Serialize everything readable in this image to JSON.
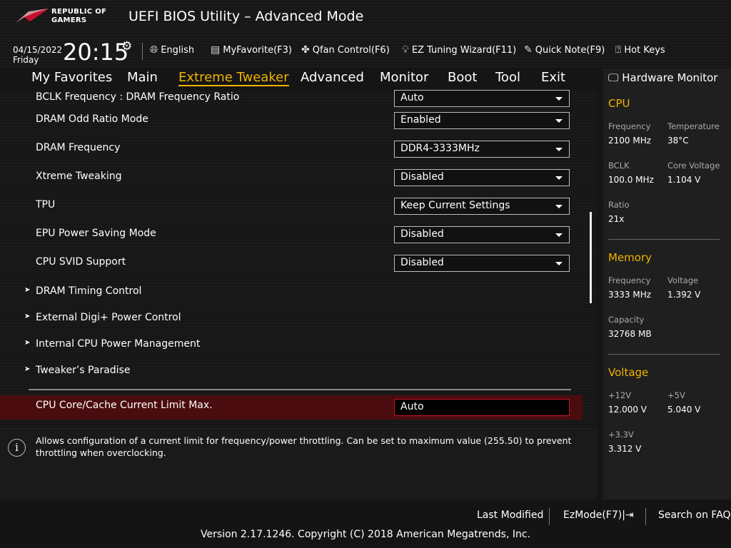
{
  "header": {
    "logo_text": [
      "REPUBLIC OF",
      "GAMERS"
    ],
    "title": "UEFI BIOS Utility – Advanced Mode",
    "date": "04/15/2022",
    "day": "Friday",
    "time": "20:15"
  },
  "toolbar": {
    "english": "English",
    "myfavorite": "MyFavorite(F3)",
    "qfan": "Qfan Control(F6)",
    "ez_tuning": "EZ Tuning Wizard(F11)",
    "quick_note": "Quick Note(F9)",
    "hot_keys": "Hot Keys"
  },
  "tabs": [
    "My Favorites",
    "Main",
    "Extreme Tweaker",
    "Advanced",
    "Monitor",
    "Boot",
    "Tool",
    "Exit"
  ],
  "settings": [
    {
      "label": "BCLK Frequency : DRAM Frequency Ratio",
      "value": "Auto"
    },
    {
      "label": "DRAM Odd Ratio Mode",
      "value": "Enabled"
    },
    {
      "label": "DRAM Frequency",
      "value": "DDR4-3333MHz"
    },
    {
      "label": "Xtreme Tweaking",
      "value": "Disabled"
    },
    {
      "label": "TPU",
      "value": "Keep Current Settings"
    },
    {
      "label": "EPU Power Saving Mode",
      "value": "Disabled"
    },
    {
      "label": "CPU SVID Support",
      "value": "Disabled"
    }
  ],
  "submenus": [
    "DRAM Timing Control",
    "External Digi+ Power Control",
    "Internal CPU Power Management",
    "Tweaker’s Paradise"
  ],
  "selected": {
    "label": "CPU Core/Cache Current Limit Max.",
    "value": "Auto"
  },
  "help": "Allows configuration of a current limit for frequency/power throttling. Can be set to maximum value (255.50) to prevent throttling when overclocking.",
  "hw": {
    "title": "Hardware Monitor",
    "cpu": {
      "title": "CPU",
      "freq_k": "Frequency",
      "freq": "2100 MHz",
      "temp_k": "Temperature",
      "temp": "38°C",
      "bclk_k": "BCLK",
      "bclk": "100.0 MHz",
      "cv_k": "Core Voltage",
      "cv": "1.104 V",
      "ratio_k": "Ratio",
      "ratio": "21x"
    },
    "mem": {
      "title": "Memory",
      "freq_k": "Frequency",
      "freq": "3333 MHz",
      "volt_k": "Voltage",
      "volt": "1.392 V",
      "cap_k": "Capacity",
      "cap": "32768 MB"
    },
    "volt": {
      "title": "Voltage",
      "v12_k": "+12V",
      "v12": "12.000 V",
      "v5_k": "+5V",
      "v5": "5.040 V",
      "v33_k": "+3.3V",
      "v33": "3.312 V"
    }
  },
  "footer": {
    "last_modified": "Last Modified",
    "ezmode": "EzMode(F7)",
    "search": "Search on FAQ",
    "version": "Version 2.17.1246. Copyright (C) 2018 American Megatrends, Inc."
  }
}
